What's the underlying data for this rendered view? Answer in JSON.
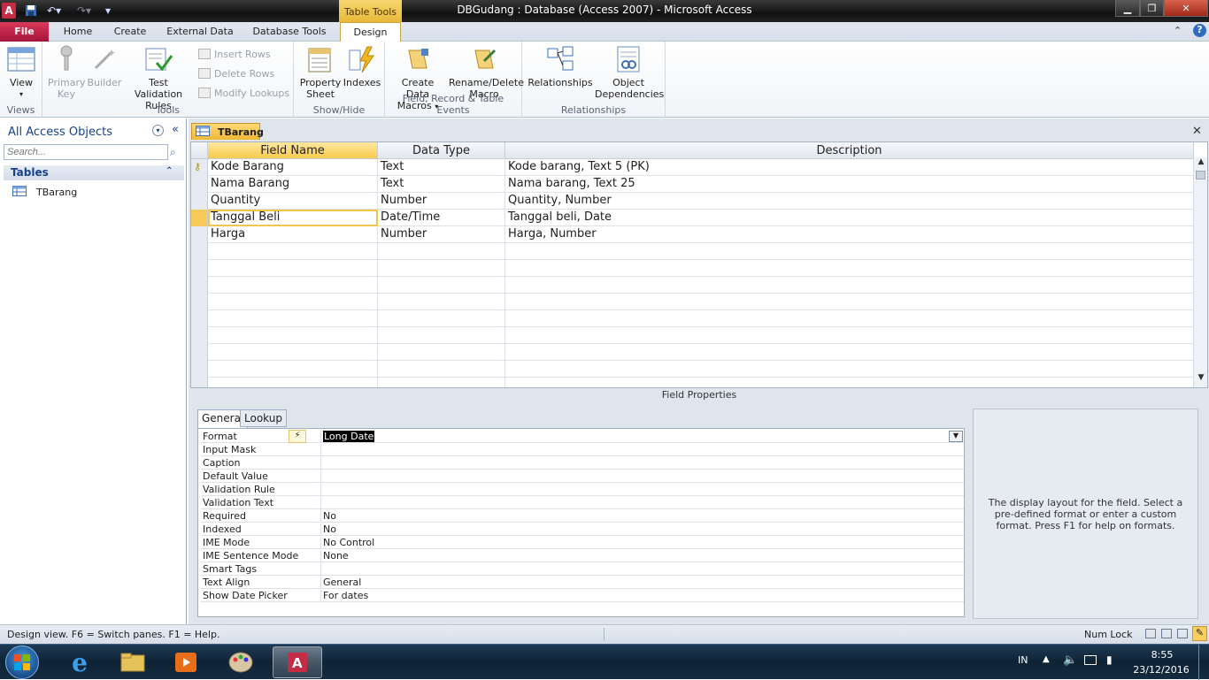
{
  "window": {
    "title": "DBGudang : Database (Access 2007)  -  Microsoft Access",
    "context_tab": "Table Tools"
  },
  "ribbon_tabs": [
    "File",
    "Home",
    "Create",
    "External Data",
    "Database Tools",
    "Design"
  ],
  "ribbon": {
    "groups": {
      "views": "Views",
      "tools": "Tools",
      "showhide": "Show/Hide",
      "events": "Field, Record & Table Events",
      "relationships": "Relationships"
    },
    "buttons": {
      "view": "View",
      "primary_key_1": "Primary",
      "primary_key_2": "Key",
      "builder": "Builder",
      "test_validation_1": "Test Validation",
      "test_validation_2": "Rules",
      "insert_rows": "Insert Rows",
      "delete_rows": "Delete Rows",
      "modify_lookups": "Modify Lookups",
      "property_sheet_1": "Property",
      "property_sheet_2": "Sheet",
      "indexes": "Indexes",
      "create_data_macros_1": "Create Data",
      "create_data_macros_2": "Macros",
      "rename_delete_macro_1": "Rename/Delete",
      "rename_delete_macro_2": "Macro",
      "relationships": "Relationships",
      "object_dependencies_1": "Object",
      "object_dependencies_2": "Dependencies"
    }
  },
  "nav": {
    "header": "All Access Objects",
    "search_placeholder": "Search...",
    "section": "Tables",
    "items": [
      "TBarang"
    ]
  },
  "document": {
    "tab": "TBarang",
    "columns": [
      "Field Name",
      "Data Type",
      "Description"
    ],
    "rows": [
      {
        "field": "Kode Barang",
        "type": "Text",
        "desc": "Kode barang, Text 5 (PK)"
      },
      {
        "field": "Nama Barang",
        "type": "Text",
        "desc": "Nama barang, Text 25"
      },
      {
        "field": "Quantity",
        "type": "Number",
        "desc": "Quantity, Number"
      },
      {
        "field": "Tanggal Beli",
        "type": "Date/Time",
        "desc": "Tanggal beli, Date"
      },
      {
        "field": "Harga",
        "type": "Number",
        "desc": "Harga, Number"
      }
    ]
  },
  "field_properties": {
    "label": "Field Properties",
    "tabs": [
      "General",
      "Lookup"
    ],
    "properties": [
      {
        "name": "Format",
        "value": "Long Date"
      },
      {
        "name": "Input Mask",
        "value": ""
      },
      {
        "name": "Caption",
        "value": ""
      },
      {
        "name": "Default Value",
        "value": ""
      },
      {
        "name": "Validation Rule",
        "value": ""
      },
      {
        "name": "Validation Text",
        "value": ""
      },
      {
        "name": "Required",
        "value": "No"
      },
      {
        "name": "Indexed",
        "value": "No"
      },
      {
        "name": "IME Mode",
        "value": "No Control"
      },
      {
        "name": "IME Sentence Mode",
        "value": "None"
      },
      {
        "name": "Smart Tags",
        "value": ""
      },
      {
        "name": "Text Align",
        "value": "General"
      },
      {
        "name": "Show Date Picker",
        "value": "For dates"
      }
    ],
    "help": "The display layout for the field. Select a pre-defined format or enter a custom format. Press F1 for help on formats."
  },
  "status": {
    "left": "Design view.  F6 = Switch panes.  F1 = Help.",
    "num_lock": "Num Lock"
  },
  "taskbar": {
    "lang": "IN",
    "time": "8:55",
    "date": "23/12/2016"
  }
}
